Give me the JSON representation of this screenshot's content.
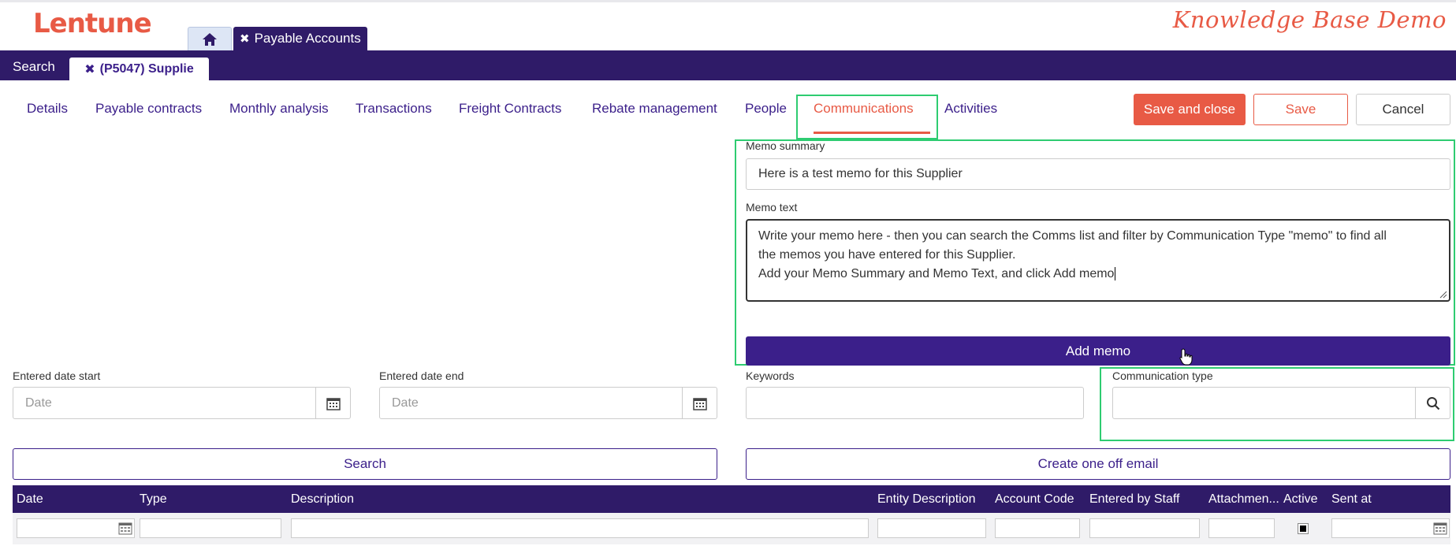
{
  "header": {
    "logo": "Lentune",
    "kb_title": "Knowledge Base Demo"
  },
  "app_tabs": {
    "home_icon": "home-icon",
    "active_tab_close": "✖",
    "active_tab_label": "Payable Accounts"
  },
  "navbar": {
    "search_label": "Search",
    "record_tab_close": "✖",
    "record_tab_label": "(P5047) Supplie"
  },
  "subtabs": [
    {
      "label": "Details"
    },
    {
      "label": "Payable contracts"
    },
    {
      "label": "Monthly analysis"
    },
    {
      "label": "Transactions"
    },
    {
      "label": "Freight Contracts"
    },
    {
      "label": "Rebate management"
    },
    {
      "label": "People"
    },
    {
      "label": "Communications",
      "active": true
    },
    {
      "label": "Activities"
    }
  ],
  "actions": {
    "save_close": "Save and close",
    "save": "Save",
    "cancel": "Cancel"
  },
  "memo": {
    "summary_label": "Memo summary",
    "summary_value": "Here is a test memo for this Supplier",
    "text_label": "Memo text",
    "text_line1": "Write your memo here - then you can search the Comms list and filter by Communication Type \"memo\" to find all",
    "text_line2": "the memos you have entered for this  Supplier.",
    "text_line3": "Add your Memo Summary and Memo Text, and click Add memo",
    "add_button": "Add memo"
  },
  "filters": {
    "date_start_label": "Entered date start",
    "date_start_placeholder": "Date",
    "date_end_label": "Entered date end",
    "date_end_placeholder": "Date",
    "keywords_label": "Keywords",
    "comm_type_label": "Communication type",
    "search_button": "Search",
    "email_button": "Create one off email"
  },
  "grid": {
    "columns": [
      "Date",
      "Type",
      "Description",
      "Entity Description",
      "Account Code",
      "Entered by Staff",
      "Attachmen...",
      "Active",
      "Sent at"
    ]
  },
  "colors": {
    "brand": "#e85a45",
    "primary": "#2f1b68",
    "accent": "#3b1f8a",
    "highlight": "#2ecc71"
  }
}
